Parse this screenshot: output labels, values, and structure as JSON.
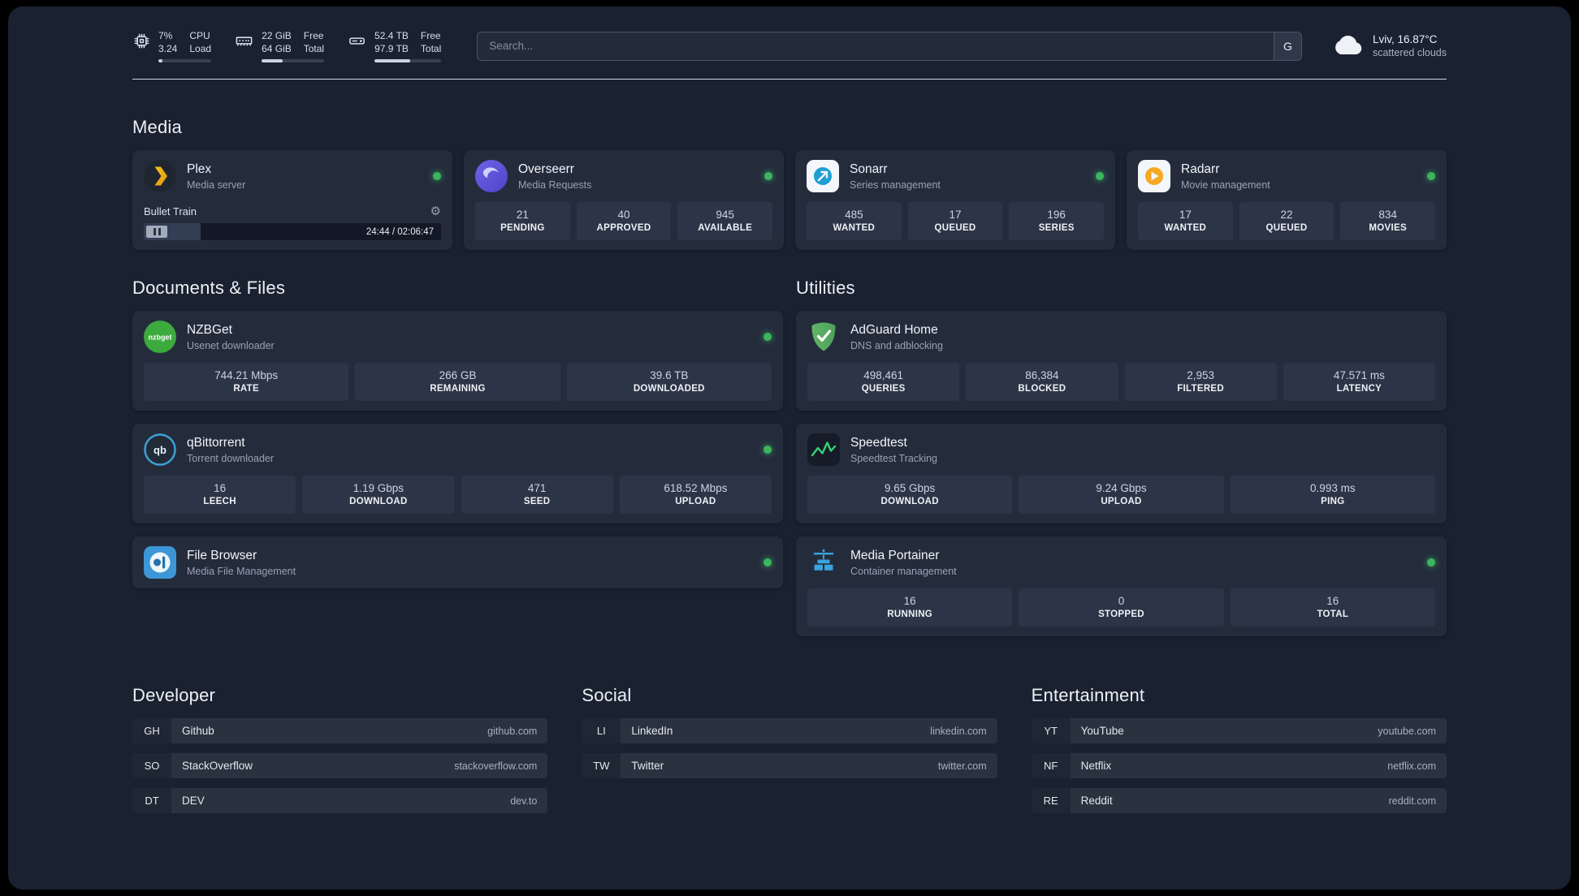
{
  "colors": {
    "background": "#1a2231",
    "card": "#242c3c",
    "status_green": "#3cb55e"
  },
  "topbar": {
    "widgets": [
      {
        "id": "cpu",
        "values": [
          "7%",
          "3.24"
        ],
        "labels": [
          "CPU",
          "Load"
        ],
        "progress": "7%"
      },
      {
        "id": "ram",
        "values": [
          "22 GiB",
          "64 GiB"
        ],
        "labels": [
          "Free",
          "Total"
        ],
        "progress": "34%"
      },
      {
        "id": "disk",
        "values": [
          "52.4 TB",
          "97.9 TB"
        ],
        "labels": [
          "Free",
          "Total"
        ],
        "progress": "53%"
      }
    ],
    "search": {
      "placeholder": "Search...",
      "engine_label": "G"
    },
    "weather": {
      "location": "Lviv, 16.87°C",
      "condition": "scattered clouds"
    }
  },
  "sections": {
    "media": {
      "title": "Media",
      "cards": [
        {
          "title": "Plex",
          "subtitle": "Media server",
          "status": "online",
          "now_playing": {
            "title": "Bullet Train",
            "time": "24:44 / 02:06:47",
            "progress": "19%"
          }
        },
        {
          "title": "Overseerr",
          "subtitle": "Media Requests",
          "status": "online",
          "stats": [
            {
              "value": "21",
              "label": "PENDING"
            },
            {
              "value": "40",
              "label": "APPROVED"
            },
            {
              "value": "945",
              "label": "AVAILABLE"
            }
          ]
        },
        {
          "title": "Sonarr",
          "subtitle": "Series management",
          "status": "online",
          "stats": [
            {
              "value": "485",
              "label": "WANTED"
            },
            {
              "value": "17",
              "label": "QUEUED"
            },
            {
              "value": "196",
              "label": "SERIES"
            }
          ]
        },
        {
          "title": "Radarr",
          "subtitle": "Movie management",
          "status": "online",
          "stats": [
            {
              "value": "17",
              "label": "WANTED"
            },
            {
              "value": "22",
              "label": "QUEUED"
            },
            {
              "value": "834",
              "label": "MOVIES"
            }
          ]
        }
      ]
    },
    "documents": {
      "title": "Documents & Files",
      "cards": [
        {
          "title": "NZBGet",
          "subtitle": "Usenet downloader",
          "status": "online",
          "stats": [
            {
              "value": "744.21 Mbps",
              "label": "RATE"
            },
            {
              "value": "266 GB",
              "label": "REMAINING"
            },
            {
              "value": "39.6 TB",
              "label": "DOWNLOADED"
            }
          ]
        },
        {
          "title": "qBittorrent",
          "subtitle": "Torrent downloader",
          "status": "online",
          "stats": [
            {
              "value": "16",
              "label": "LEECH"
            },
            {
              "value": "1.19 Gbps",
              "label": "DOWNLOAD"
            },
            {
              "value": "471",
              "label": "SEED"
            },
            {
              "value": "618.52 Mbps",
              "label": "UPLOAD"
            }
          ]
        },
        {
          "title": "File Browser",
          "subtitle": "Media File Management",
          "status": "online",
          "stats": []
        }
      ]
    },
    "utilities": {
      "title": "Utilities",
      "cards": [
        {
          "title": "AdGuard Home",
          "subtitle": "DNS and adblocking",
          "stats": [
            {
              "value": "498,461",
              "label": "QUERIES"
            },
            {
              "value": "86,384",
              "label": "BLOCKED"
            },
            {
              "value": "2,953",
              "label": "FILTERED"
            },
            {
              "value": "47.571 ms",
              "label": "LATENCY"
            }
          ]
        },
        {
          "title": "Speedtest",
          "subtitle": "Speedtest Tracking",
          "stats": [
            {
              "value": "9.65 Gbps",
              "label": "DOWNLOAD"
            },
            {
              "value": "9.24 Gbps",
              "label": "UPLOAD"
            },
            {
              "value": "0.993 ms",
              "label": "PING"
            }
          ]
        },
        {
          "title": "Media Portainer",
          "subtitle": "Container management",
          "status": "online",
          "stats": [
            {
              "value": "16",
              "label": "RUNNING"
            },
            {
              "value": "0",
              "label": "STOPPED"
            },
            {
              "value": "16",
              "label": "TOTAL"
            }
          ]
        }
      ]
    },
    "bookmarks": [
      {
        "title": "Developer",
        "items": [
          {
            "abbr": "GH",
            "name": "Github",
            "url": "github.com"
          },
          {
            "abbr": "SO",
            "name": "StackOverflow",
            "url": "stackoverflow.com"
          },
          {
            "abbr": "DT",
            "name": "DEV",
            "url": "dev.to"
          }
        ]
      },
      {
        "title": "Social",
        "items": [
          {
            "abbr": "LI",
            "name": "LinkedIn",
            "url": "linkedin.com"
          },
          {
            "abbr": "TW",
            "name": "Twitter",
            "url": "twitter.com"
          }
        ]
      },
      {
        "title": "Entertainment",
        "items": [
          {
            "abbr": "YT",
            "name": "YouTube",
            "url": "youtube.com"
          },
          {
            "abbr": "NF",
            "name": "Netflix",
            "url": "netflix.com"
          },
          {
            "abbr": "RE",
            "name": "Reddit",
            "url": "reddit.com"
          }
        ]
      }
    ]
  }
}
